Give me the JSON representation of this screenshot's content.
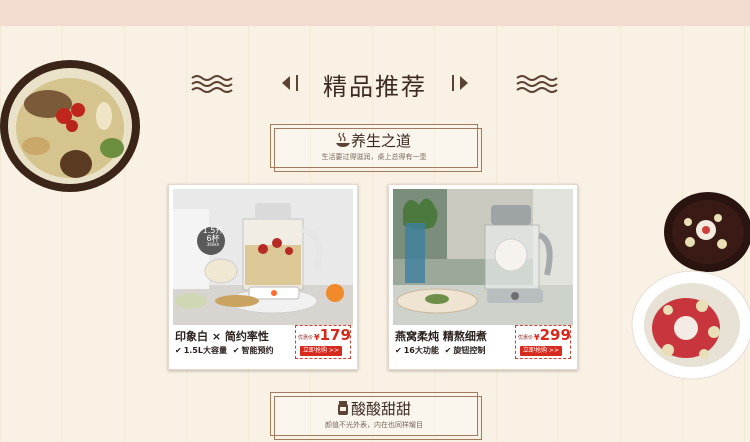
{
  "header": {
    "title": "精品推荐"
  },
  "section1": {
    "title": "养生之道",
    "subtitle": "生活要过得滋润，桌上总得有一壶"
  },
  "section2": {
    "title": "酸酸甜甜",
    "subtitle": "颜值不光外表，内在也同样耀目"
  },
  "products": [
    {
      "tagline": "印象白 × 简约率性",
      "features": [
        "1.5L大容量",
        "智能预约"
      ],
      "badge_top": "1.5升",
      "badge_mid": "6杯",
      "badge_bottom": "360kh",
      "price_label": "优惠价",
      "price_symbol": "¥",
      "price": "179",
      "buy_label": "立即抢购 >>"
    },
    {
      "tagline": "燕窝柔炖 精熬细煮",
      "features": [
        "16大功能",
        "旋钮控制"
      ],
      "price_label": "优惠价",
      "price_symbol": "¥",
      "price": "299",
      "buy_label": "立即抢购 >>"
    }
  ],
  "colors": {
    "background": "#f8f1e4",
    "accent_red": "#d62a1d",
    "frame_brown": "#a47a5d",
    "text_dark": "#3c2b22"
  }
}
